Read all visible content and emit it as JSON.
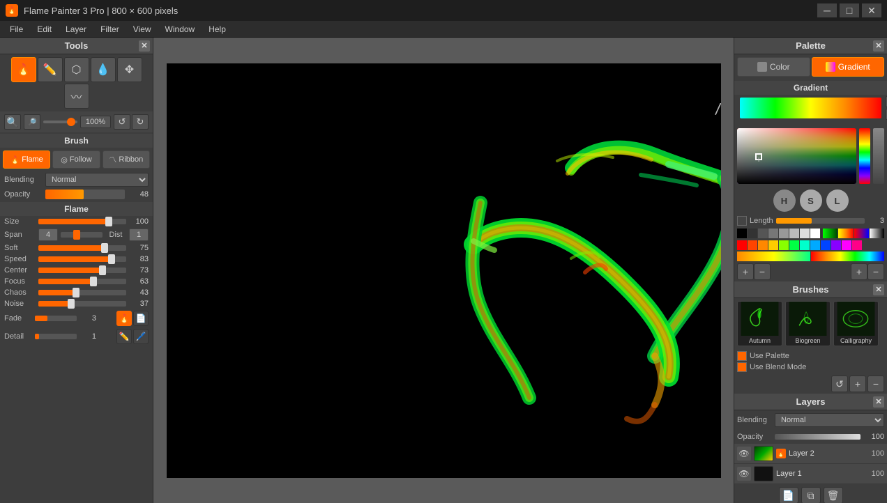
{
  "titlebar": {
    "icon": "🔥",
    "title": "Flame Painter 3 Pro | 800 × 600 pixels",
    "minimize": "─",
    "maximize": "□",
    "close": "✕"
  },
  "menubar": {
    "items": [
      "File",
      "Edit",
      "Layer",
      "Filter",
      "View",
      "Window",
      "Help"
    ]
  },
  "tools_panel": {
    "title": "Tools",
    "tools": [
      "flame",
      "pen",
      "lasso",
      "drop",
      "transform",
      "wave"
    ],
    "zoom_in": "+",
    "zoom_out": "−",
    "zoom_value": "100%",
    "reset": "↺",
    "redo": "↻"
  },
  "brush_panel": {
    "title": "Brush",
    "modes": [
      {
        "id": "flame",
        "label": "Flame",
        "active": true
      },
      {
        "id": "follow",
        "label": "Follow",
        "active": false
      },
      {
        "id": "ribbon",
        "label": "Ribbon",
        "active": false
      }
    ],
    "blending_label": "Blending",
    "blending_value": "Normal",
    "opacity_label": "Opacity",
    "opacity_value": "48"
  },
  "flame_panel": {
    "title": "Flame",
    "sliders": [
      {
        "label": "Size",
        "value": 100,
        "percent": 80
      },
      {
        "label": "Soft",
        "value": 75,
        "percent": 75
      },
      {
        "label": "Speed",
        "value": 83,
        "percent": 83
      },
      {
        "label": "Center",
        "value": 73,
        "percent": 73
      },
      {
        "label": "Focus",
        "value": 63,
        "percent": 63
      },
      {
        "label": "Chaos",
        "value": 43,
        "percent": 43
      },
      {
        "label": "Noise",
        "value": 37,
        "percent": 37
      }
    ],
    "span_label": "Span",
    "span_value": "4",
    "dist_label": "Dist",
    "dist_value": "1",
    "fade_label": "Fade",
    "fade_value": "3",
    "detail_label": "Detail",
    "detail_value": "1"
  },
  "palette_panel": {
    "title": "Palette",
    "color_btn": "Color",
    "gradient_btn": "Gradient",
    "gradient_title": "Gradient",
    "h_btn": "H",
    "s_btn": "S",
    "l_btn": "L",
    "length_label": "Length",
    "length_value": "3"
  },
  "brushes_panel": {
    "title": "Brushes",
    "brushes": [
      {
        "name": "Autumn",
        "color": "#4a7a20"
      },
      {
        "name": "Biogreen",
        "color": "#2a6a10"
      },
      {
        "name": "Calligraphy",
        "color": "#1a4a10"
      }
    ],
    "use_palette": "Use Palette",
    "use_blend": "Use Blend Mode"
  },
  "layers_panel": {
    "title": "Layers",
    "blending_label": "Blending",
    "blending_value": "Normal",
    "opacity_label": "Opacity",
    "opacity_value": "100",
    "layers": [
      {
        "name": "Layer 2",
        "opacity": "100",
        "visible": true,
        "has_flame": true
      },
      {
        "name": "Layer 1",
        "opacity": "100",
        "visible": true,
        "has_flame": false
      }
    ]
  }
}
